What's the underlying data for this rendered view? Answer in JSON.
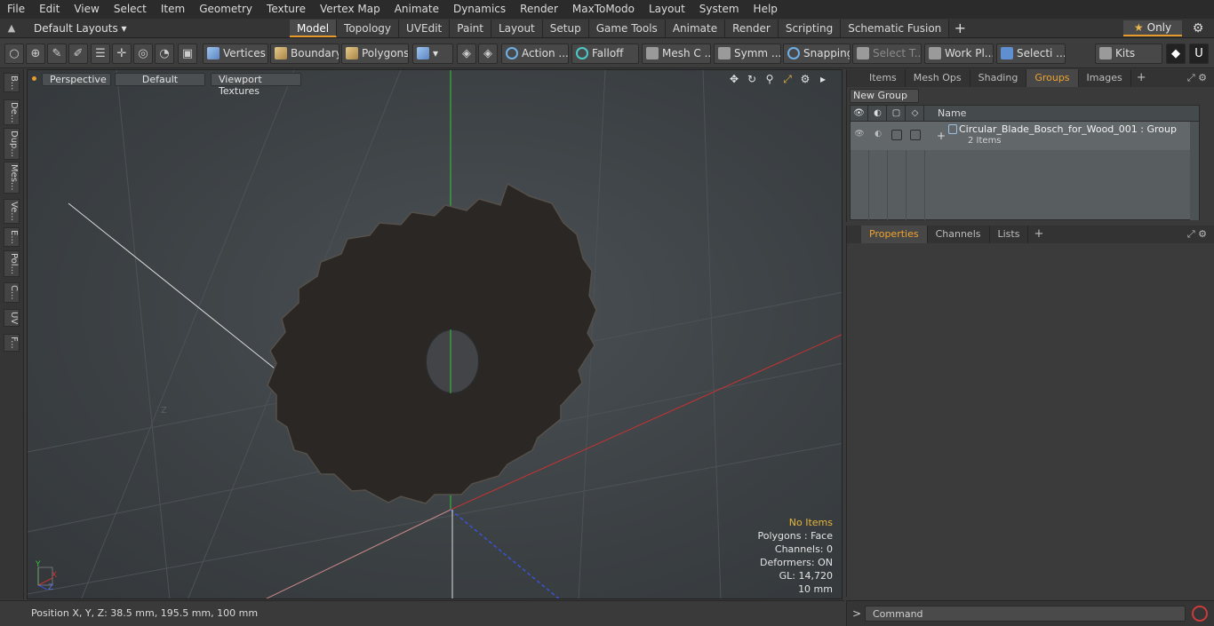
{
  "menu": [
    "File",
    "Edit",
    "View",
    "Select",
    "Item",
    "Geometry",
    "Texture",
    "Vertex Map",
    "Animate",
    "Dynamics",
    "Render",
    "MaxToModo",
    "Layout",
    "System",
    "Help"
  ],
  "layout_select": "Default Layouts ▾",
  "tabs": [
    "Model",
    "Topology",
    "UVEdit",
    "Paint",
    "Layout",
    "Setup",
    "Game Tools",
    "Animate",
    "Render",
    "Scripting",
    "Schematic Fusion"
  ],
  "active_tab": "Model",
  "only_label": "Only",
  "toolbar": {
    "vertices": "Vertices",
    "boundary": "Boundary",
    "polygons": "Polygons",
    "action": "Action",
    "falloff": "Falloff",
    "mesh": "Mesh C ...",
    "symm": "Symm ...",
    "snapping": "Snapping",
    "select_t": "Select T...",
    "work_pl": "Work Pl...",
    "selecti": "Selecti ...",
    "kits": "Kits"
  },
  "left_tabs": [
    "B...",
    "De...",
    "Dup...",
    "Mes...",
    "Ve...",
    "E...",
    "Pol...",
    "C...",
    "UV",
    "F..."
  ],
  "viewport": {
    "view_mode": "Perspective",
    "shading": "Default",
    "textures": "Viewport Textures",
    "info": {
      "selection": "No Items",
      "polygons": "Polygons : Face",
      "channels": "Channels: 0",
      "deformers": "Deformers: ON",
      "gl": "GL: 14,720",
      "scale": "10 mm"
    },
    "axis_y": "Y",
    "axis_x": "X",
    "axis_z": "Z"
  },
  "status": {
    "position": "Position X, Y, Z:   38.5 mm, 195.5 mm, 100 mm"
  },
  "right_panel": {
    "tabs": [
      "Items",
      "Mesh Ops",
      "Shading",
      "Groups",
      "Images"
    ],
    "active_tab": "Groups",
    "new_group": "New Group",
    "column_name": "Name",
    "group": {
      "name": "Circular_Blade_Bosch_for_Wood_001 : Group",
      "count": "2 Items"
    }
  },
  "properties_panel": {
    "tabs": [
      "Properties",
      "Channels",
      "Lists"
    ],
    "active_tab": "Properties"
  },
  "command": {
    "placeholder": "Command"
  },
  "colors": {
    "accent": "#e59a2b",
    "x_axis": "#c53333",
    "y_axis": "#39c339",
    "z_axis": "#3a53d6"
  }
}
